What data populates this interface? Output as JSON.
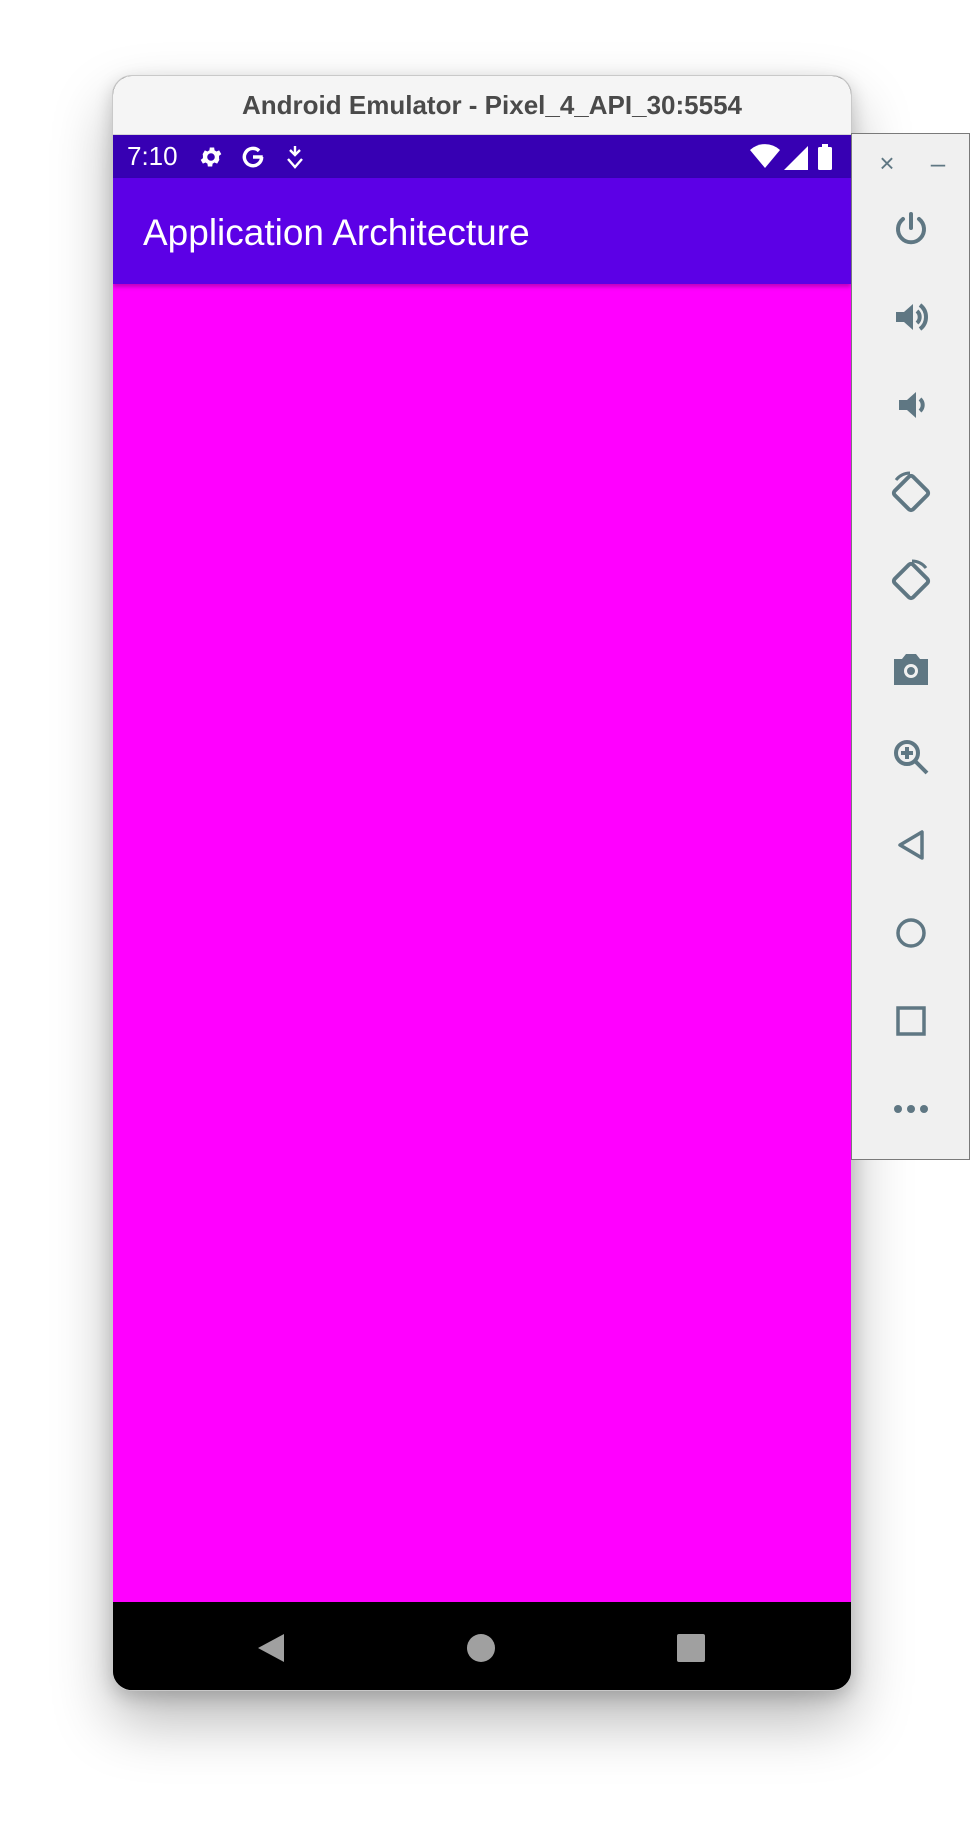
{
  "window": {
    "title": "Android Emulator - Pixel_4_API_30:5554"
  },
  "statusbar": {
    "time": "7:10",
    "icons": [
      "settings-icon",
      "google-icon",
      "download-icon",
      "wifi-icon",
      "signal-icon",
      "battery-icon"
    ]
  },
  "appbar": {
    "title": "Application Architecture"
  },
  "navbar": {
    "buttons": [
      "back-icon",
      "home-icon",
      "recents-icon"
    ]
  },
  "sidebar": {
    "close_label": "×",
    "minimize_label": "–",
    "buttons": [
      "power-icon",
      "volume-up-icon",
      "volume-down-icon",
      "rotate-left-icon",
      "rotate-right-icon",
      "camera-icon",
      "zoom-icon",
      "back-icon",
      "home-icon",
      "overview-icon",
      "more-icon"
    ]
  },
  "colors": {
    "statusbar": "#3700b3",
    "appbar": "#5c00e6",
    "content": "#ff00ff",
    "navbar": "#000000",
    "sidebar_icon": "#5f7783"
  }
}
